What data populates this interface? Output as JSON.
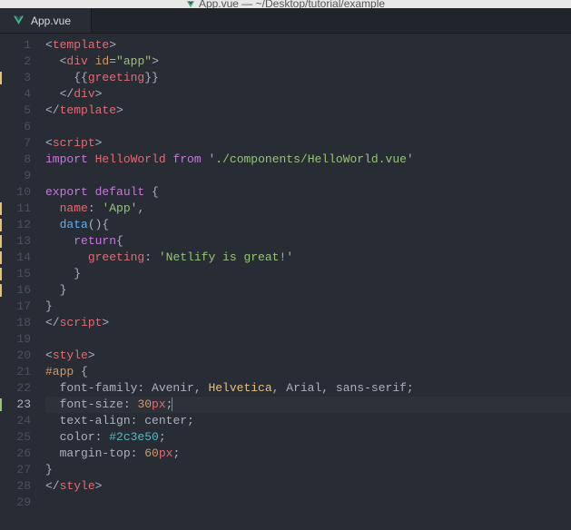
{
  "window": {
    "title": "App.vue — ~/Desktop/tutorial/example"
  },
  "tab": {
    "filename": "App.vue",
    "icon": "vue-file-icon"
  },
  "editor": {
    "active_line": 23,
    "marked_lines": [
      3,
      11,
      12,
      13,
      14,
      15,
      16,
      23
    ],
    "line_count": 29
  },
  "code": {
    "lines": [
      {
        "n": 1,
        "t": [
          [
            "p",
            "<"
          ],
          [
            "r",
            "template"
          ],
          [
            "p",
            ">"
          ]
        ]
      },
      {
        "n": 2,
        "t": [
          [
            "p",
            "  <"
          ],
          [
            "r",
            "div"
          ],
          [
            "p",
            " "
          ],
          [
            "o",
            "id"
          ],
          [
            "p",
            "="
          ],
          [
            "g",
            "\"app\""
          ],
          [
            "p",
            ">"
          ]
        ]
      },
      {
        "n": 3,
        "t": [
          [
            "p",
            "    {{"
          ],
          [
            "r",
            "greeting"
          ],
          [
            "p",
            "}}"
          ]
        ]
      },
      {
        "n": 4,
        "t": [
          [
            "p",
            "  </"
          ],
          [
            "r",
            "div"
          ],
          [
            "p",
            ">"
          ]
        ]
      },
      {
        "n": 5,
        "t": [
          [
            "p",
            "</"
          ],
          [
            "r",
            "template"
          ],
          [
            "p",
            ">"
          ]
        ]
      },
      {
        "n": 6,
        "t": []
      },
      {
        "n": 7,
        "t": [
          [
            "p",
            "<"
          ],
          [
            "r",
            "script"
          ],
          [
            "p",
            ">"
          ]
        ]
      },
      {
        "n": 8,
        "t": [
          [
            "pu",
            "import"
          ],
          [
            "p",
            " "
          ],
          [
            "r",
            "HelloWorld"
          ],
          [
            "p",
            " "
          ],
          [
            "pu",
            "from"
          ],
          [
            "p",
            " "
          ],
          [
            "g",
            "'./components/HelloWorld.vue'"
          ]
        ]
      },
      {
        "n": 9,
        "t": []
      },
      {
        "n": 10,
        "t": [
          [
            "pu",
            "export"
          ],
          [
            "p",
            " "
          ],
          [
            "pu",
            "default"
          ],
          [
            "p",
            " {"
          ]
        ]
      },
      {
        "n": 11,
        "t": [
          [
            "p",
            "  "
          ],
          [
            "r",
            "name"
          ],
          [
            "p",
            ": "
          ],
          [
            "g",
            "'App'"
          ],
          [
            "p",
            ","
          ]
        ]
      },
      {
        "n": 12,
        "t": [
          [
            "p",
            "  "
          ],
          [
            "b",
            "data"
          ],
          [
            "p",
            "(){"
          ]
        ]
      },
      {
        "n": 13,
        "t": [
          [
            "p",
            "    "
          ],
          [
            "pu",
            "return"
          ],
          [
            "p",
            "{"
          ]
        ]
      },
      {
        "n": 14,
        "t": [
          [
            "p",
            "      "
          ],
          [
            "r",
            "greeting"
          ],
          [
            "p",
            ": "
          ],
          [
            "g",
            "'Netlify is great!'"
          ]
        ]
      },
      {
        "n": 15,
        "t": [
          [
            "p",
            "    }"
          ]
        ]
      },
      {
        "n": 16,
        "t": [
          [
            "p",
            "  }"
          ]
        ]
      },
      {
        "n": 17,
        "t": [
          [
            "p",
            "}"
          ]
        ]
      },
      {
        "n": 18,
        "t": [
          [
            "p",
            "</"
          ],
          [
            "r",
            "script"
          ],
          [
            "p",
            ">"
          ]
        ]
      },
      {
        "n": 19,
        "t": []
      },
      {
        "n": 20,
        "t": [
          [
            "p",
            "<"
          ],
          [
            "r",
            "style"
          ],
          [
            "p",
            ">"
          ]
        ]
      },
      {
        "n": 21,
        "t": [
          [
            "o",
            "#app"
          ],
          [
            "p",
            " {"
          ]
        ]
      },
      {
        "n": 22,
        "t": [
          [
            "p",
            "  font-family"
          ],
          [
            "p",
            ": "
          ],
          [
            "w",
            "Avenir"
          ],
          [
            "p",
            ", "
          ],
          [
            "y",
            "Helvetica"
          ],
          [
            "p",
            ", "
          ],
          [
            "w",
            "Arial"
          ],
          [
            "p",
            ", "
          ],
          [
            "w",
            "sans-serif"
          ],
          [
            "p",
            ";"
          ]
        ]
      },
      {
        "n": 23,
        "t": [
          [
            "p",
            "  font-size"
          ],
          [
            "p",
            ": "
          ],
          [
            "o",
            "30"
          ],
          [
            "r",
            "px"
          ],
          [
            "p",
            ";"
          ]
        ]
      },
      {
        "n": 24,
        "t": [
          [
            "p",
            "  text-align"
          ],
          [
            "p",
            ": "
          ],
          [
            "w",
            "center"
          ],
          [
            "p",
            ";"
          ]
        ]
      },
      {
        "n": 25,
        "t": [
          [
            "p",
            "  color"
          ],
          [
            "p",
            ": "
          ],
          [
            "cy",
            "#2c3e50"
          ],
          [
            "p",
            ";"
          ]
        ]
      },
      {
        "n": 26,
        "t": [
          [
            "p",
            "  margin-top"
          ],
          [
            "p",
            ": "
          ],
          [
            "o",
            "60"
          ],
          [
            "r",
            "px"
          ],
          [
            "p",
            ";"
          ]
        ]
      },
      {
        "n": 27,
        "t": [
          [
            "p",
            "}"
          ]
        ]
      },
      {
        "n": 28,
        "t": [
          [
            "p",
            "</"
          ],
          [
            "r",
            "style"
          ],
          [
            "p",
            ">"
          ]
        ]
      },
      {
        "n": 29,
        "t": []
      }
    ]
  },
  "colors": {
    "mark": "#e5c07b",
    "mark_alt": "#98c379"
  }
}
